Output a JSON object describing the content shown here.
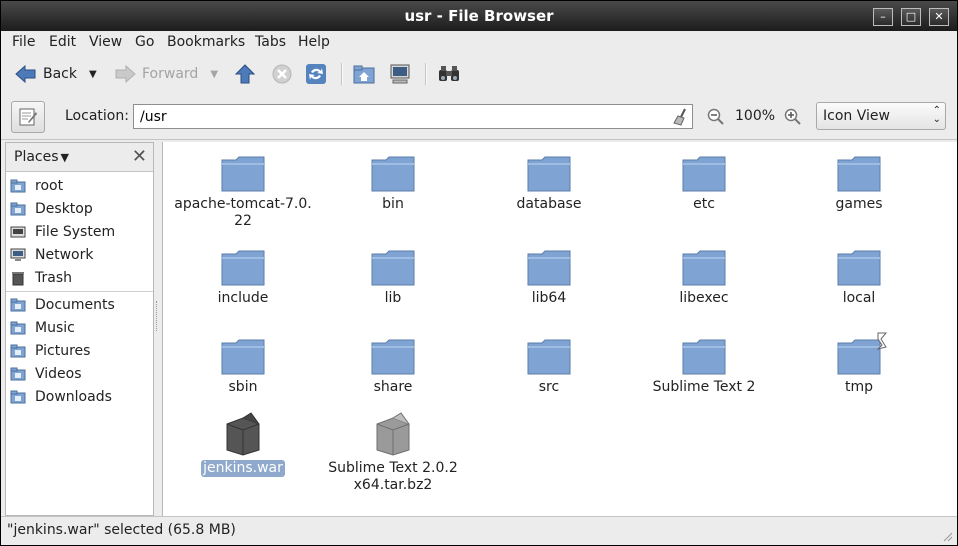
{
  "window": {
    "title": "usr - File Browser"
  },
  "menubar": {
    "items": [
      "File",
      "Edit",
      "View",
      "Go",
      "Bookmarks",
      "Tabs",
      "Help"
    ]
  },
  "toolbar": {
    "back_label": "Back",
    "forward_label": "Forward"
  },
  "location": {
    "label": "Location:",
    "value": "/usr",
    "zoom": "100%",
    "view_mode": "Icon View"
  },
  "sidebar": {
    "header": "Places",
    "items": [
      "root",
      "Desktop",
      "File System",
      "Network",
      "Trash",
      "Documents",
      "Music",
      "Pictures",
      "Videos",
      "Downloads"
    ]
  },
  "files": {
    "items": [
      {
        "name": "apache-tomcat-7.0.22",
        "line1": "apache-tomcat-7.0.",
        "line2": "22",
        "type": "folder"
      },
      {
        "name": "bin",
        "type": "folder"
      },
      {
        "name": "database",
        "type": "folder"
      },
      {
        "name": "etc",
        "type": "folder"
      },
      {
        "name": "games",
        "type": "folder"
      },
      {
        "name": "include",
        "type": "folder"
      },
      {
        "name": "lib",
        "type": "folder"
      },
      {
        "name": "lib64",
        "type": "folder"
      },
      {
        "name": "libexec",
        "type": "folder"
      },
      {
        "name": "local",
        "type": "folder"
      },
      {
        "name": "sbin",
        "type": "folder"
      },
      {
        "name": "share",
        "type": "folder"
      },
      {
        "name": "src",
        "type": "folder"
      },
      {
        "name": "Sublime Text 2",
        "type": "folder"
      },
      {
        "name": "tmp",
        "type": "folder"
      },
      {
        "name": "jenkins.war",
        "type": "archive-dark",
        "selected": true
      },
      {
        "name": "Sublime Text 2.0.2 x64.tar.bz2",
        "line1": "Sublime Text 2.0.2",
        "line2": "x64.tar.bz2",
        "type": "archive"
      }
    ]
  },
  "status": {
    "text": "\"jenkins.war\" selected (65.8 MB)"
  },
  "colors": {
    "folder": "#7fa4d4",
    "selection": "#8fa9cc",
    "titlebar": "#2a2a2a"
  }
}
